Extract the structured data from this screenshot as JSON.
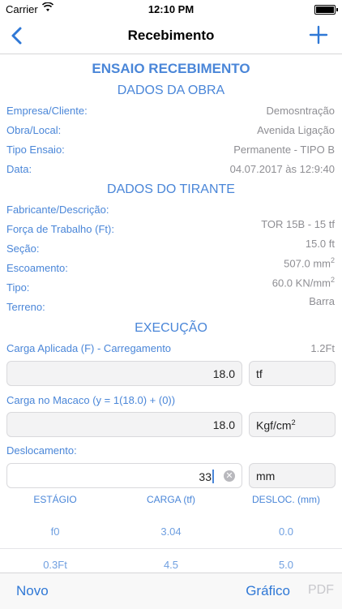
{
  "status_bar": {
    "carrier": "Carrier",
    "time": "12:10 PM"
  },
  "nav": {
    "title": "Recebimento"
  },
  "header": {
    "main": "ENSAIO RECEBIMENTO"
  },
  "obra": {
    "title": "DADOS DA OBRA",
    "rows": [
      {
        "label": "Empresa/Cliente:",
        "value": "Demosntração"
      },
      {
        "label": "Obra/Local:",
        "value": "Avenida Ligação"
      },
      {
        "label": "Tipo Ensaio:",
        "value": "Permanente - TIPO B"
      },
      {
        "label": "Data:",
        "value": "04.07.2017 às 12:9:40"
      }
    ]
  },
  "tirante": {
    "title": "DADOS DO TIRANTE",
    "rows": [
      {
        "label": "Fabricante/Descrição:",
        "value": ""
      },
      {
        "label": "Força de Trabalho (Ft):",
        "value": "TOR 15B - 15 tf"
      },
      {
        "label": "Seção:",
        "value": "15.0 ft"
      },
      {
        "label": "Escoamento:",
        "value": "507.0 mm",
        "sup": "2"
      },
      {
        "label": "Tipo:",
        "value": "60.0 KN/mm",
        "sup": "2"
      },
      {
        "label": "Terreno:",
        "value": "Barra"
      }
    ]
  },
  "execucao": {
    "title": "EXECUÇÃO",
    "carga_label": "Carga Aplicada (F) - Carregamento",
    "carga_ratio": "1.2Ft",
    "carga_value": "18.0",
    "carga_unit": "tf",
    "macaco_label": "Carga no Macaco (y = 1(18.0) + (0))",
    "macaco_value": "18.0",
    "macaco_unit": "Kgf/cm",
    "macaco_unit_sup": "2",
    "desloc_label": "Deslocamento:",
    "desloc_value": "33",
    "desloc_unit": "mm"
  },
  "table": {
    "headers": [
      "ESTÁGIO",
      "CARGA (tf)",
      "DESLOC. (mm)"
    ],
    "rows": [
      [
        "f0",
        "3.04",
        "0.0"
      ],
      [
        "0.3Ft",
        "4.5",
        "5.0"
      ]
    ]
  },
  "toolbar": {
    "novo": "Novo",
    "grafico": "Gráfico",
    "pdf": "PDF"
  },
  "colors": {
    "accent": "#4a86d8",
    "muted": "#8e8e93",
    "field_bg": "#f3f3f4"
  }
}
